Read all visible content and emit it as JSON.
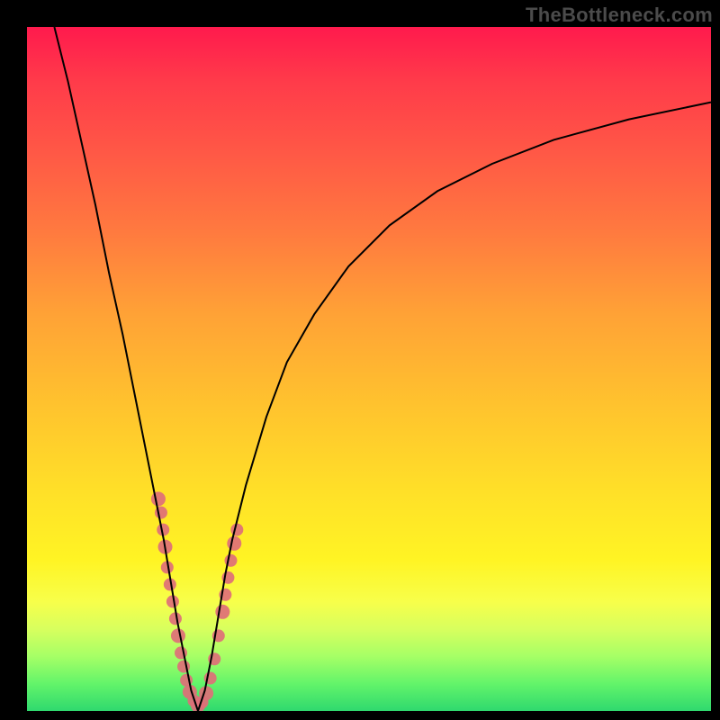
{
  "watermark": "TheBottleneck.com",
  "colors": {
    "frame_bg": "#000000",
    "gradient_top": "#ff1a4d",
    "gradient_mid": "#ffe028",
    "gradient_bottom": "#2fd96e",
    "curve": "#000000",
    "spot": "#de6f78"
  },
  "chart_data": {
    "type": "line",
    "title": "",
    "xlabel": "",
    "ylabel": "",
    "xlim": [
      0,
      100
    ],
    "ylim": [
      0,
      100
    ],
    "minimum_x": 25,
    "curve_left": {
      "comment": "left branch of the V-shaped bottleneck curve, x ascending toward minimum",
      "x": [
        4,
        6,
        8,
        10,
        12,
        14,
        16,
        18,
        19,
        20,
        21,
        22,
        23,
        24,
        25
      ],
      "y_pct": [
        100,
        92,
        83,
        74,
        64,
        55,
        45,
        35,
        30,
        25,
        19,
        13,
        8,
        3,
        0
      ]
    },
    "curve_right": {
      "comment": "right branch rising then flattening toward the right edge",
      "x": [
        25,
        26,
        27,
        28,
        29,
        30,
        32,
        35,
        38,
        42,
        47,
        53,
        60,
        68,
        77,
        88,
        100
      ],
      "y_pct": [
        0,
        3,
        8,
        14,
        20,
        25,
        33,
        43,
        51,
        58,
        65,
        71,
        76,
        80,
        83.5,
        86.5,
        89
      ]
    },
    "spots": {
      "comment": "clusters of pink/salmon dots near the valley along both branches; y_pct is height above bottom (0=bottom)",
      "points": [
        {
          "x": 19.2,
          "y_pct": 31.0,
          "r": 8
        },
        {
          "x": 19.6,
          "y_pct": 29.0,
          "r": 7
        },
        {
          "x": 19.9,
          "y_pct": 26.5,
          "r": 7
        },
        {
          "x": 20.2,
          "y_pct": 24.0,
          "r": 8
        },
        {
          "x": 20.5,
          "y_pct": 21.0,
          "r": 7
        },
        {
          "x": 20.9,
          "y_pct": 18.5,
          "r": 7
        },
        {
          "x": 21.3,
          "y_pct": 16.0,
          "r": 7
        },
        {
          "x": 21.7,
          "y_pct": 13.5,
          "r": 7
        },
        {
          "x": 22.1,
          "y_pct": 11.0,
          "r": 8
        },
        {
          "x": 22.5,
          "y_pct": 8.5,
          "r": 7
        },
        {
          "x": 22.9,
          "y_pct": 6.5,
          "r": 7
        },
        {
          "x": 23.3,
          "y_pct": 4.5,
          "r": 7
        },
        {
          "x": 23.8,
          "y_pct": 2.8,
          "r": 8
        },
        {
          "x": 24.4,
          "y_pct": 1.5,
          "r": 7
        },
        {
          "x": 25.0,
          "y_pct": 0.8,
          "r": 8
        },
        {
          "x": 25.6,
          "y_pct": 1.3,
          "r": 7
        },
        {
          "x": 26.2,
          "y_pct": 2.6,
          "r": 8
        },
        {
          "x": 26.8,
          "y_pct": 4.8,
          "r": 7
        },
        {
          "x": 27.4,
          "y_pct": 7.6,
          "r": 7
        },
        {
          "x": 28.0,
          "y_pct": 11.0,
          "r": 7
        },
        {
          "x": 28.6,
          "y_pct": 14.5,
          "r": 8
        },
        {
          "x": 29.0,
          "y_pct": 17.0,
          "r": 7
        },
        {
          "x": 29.4,
          "y_pct": 19.5,
          "r": 7
        },
        {
          "x": 29.8,
          "y_pct": 22.0,
          "r": 7
        },
        {
          "x": 30.3,
          "y_pct": 24.5,
          "r": 8
        },
        {
          "x": 30.7,
          "y_pct": 26.5,
          "r": 7
        }
      ]
    }
  }
}
